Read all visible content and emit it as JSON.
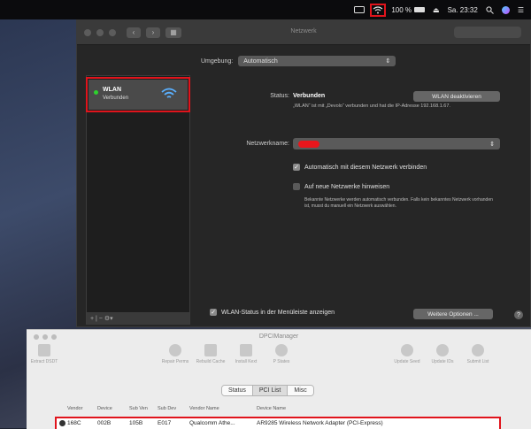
{
  "menubar": {
    "battery_text": "100 %",
    "clock": "Sa. 23:32"
  },
  "window": {
    "title": "Netzwerk",
    "umgebung_label": "Umgebung:",
    "umgebung_value": "Automatisch",
    "service": {
      "name": "WLAN",
      "status": "Verbunden"
    },
    "status_label": "Status:",
    "status_value": "Verbunden",
    "deactivate_button": "WLAN deaktivieren",
    "status_description": "„WLAN“ ist mit „Devolo“ verbunden und hat die IP-Adresse 192.168.1.67.",
    "network_name_label": "Netzwerkname:",
    "auto_connect_label": "Automatisch mit diesem Netzwerk verbinden",
    "ask_new_label": "Auf neue Netzwerke hinweisen",
    "ask_new_hint": "Bekannte Netzwerke werden automatisch verbunden. Falls kein bekanntes Netzwerk vorhanden ist, musst du manuell ein Netzwerk auswählen.",
    "menubar_status_label": "WLAN-Status in der Menüleiste anzeigen",
    "more_options_button": "Weitere Optionen ...",
    "help_symbol": "?",
    "sidebar_controls": "+ | − ⚙▾"
  },
  "dpc": {
    "title": "DPCIManager",
    "tools": {
      "extract": "Extract DSDT",
      "repair": "Repair Perms",
      "rebuild": "Rebuild Cache",
      "install": "Install Kext",
      "pstates": "P States",
      "update_seed": "Update Seed",
      "update_ids": "Update IDs",
      "submit": "Submit List"
    },
    "tabs": [
      "Status",
      "PCI List",
      "Misc"
    ],
    "columns": [
      "Vendor",
      "Device",
      "Sub Ven",
      "Sub Dev",
      "Vendor Name",
      "Device Name"
    ],
    "row": [
      "168C",
      "002B",
      "105B",
      "E017",
      "Qualcomm Athe...",
      "AR9285 Wireless Network Adapter (PCI-Express)"
    ]
  }
}
